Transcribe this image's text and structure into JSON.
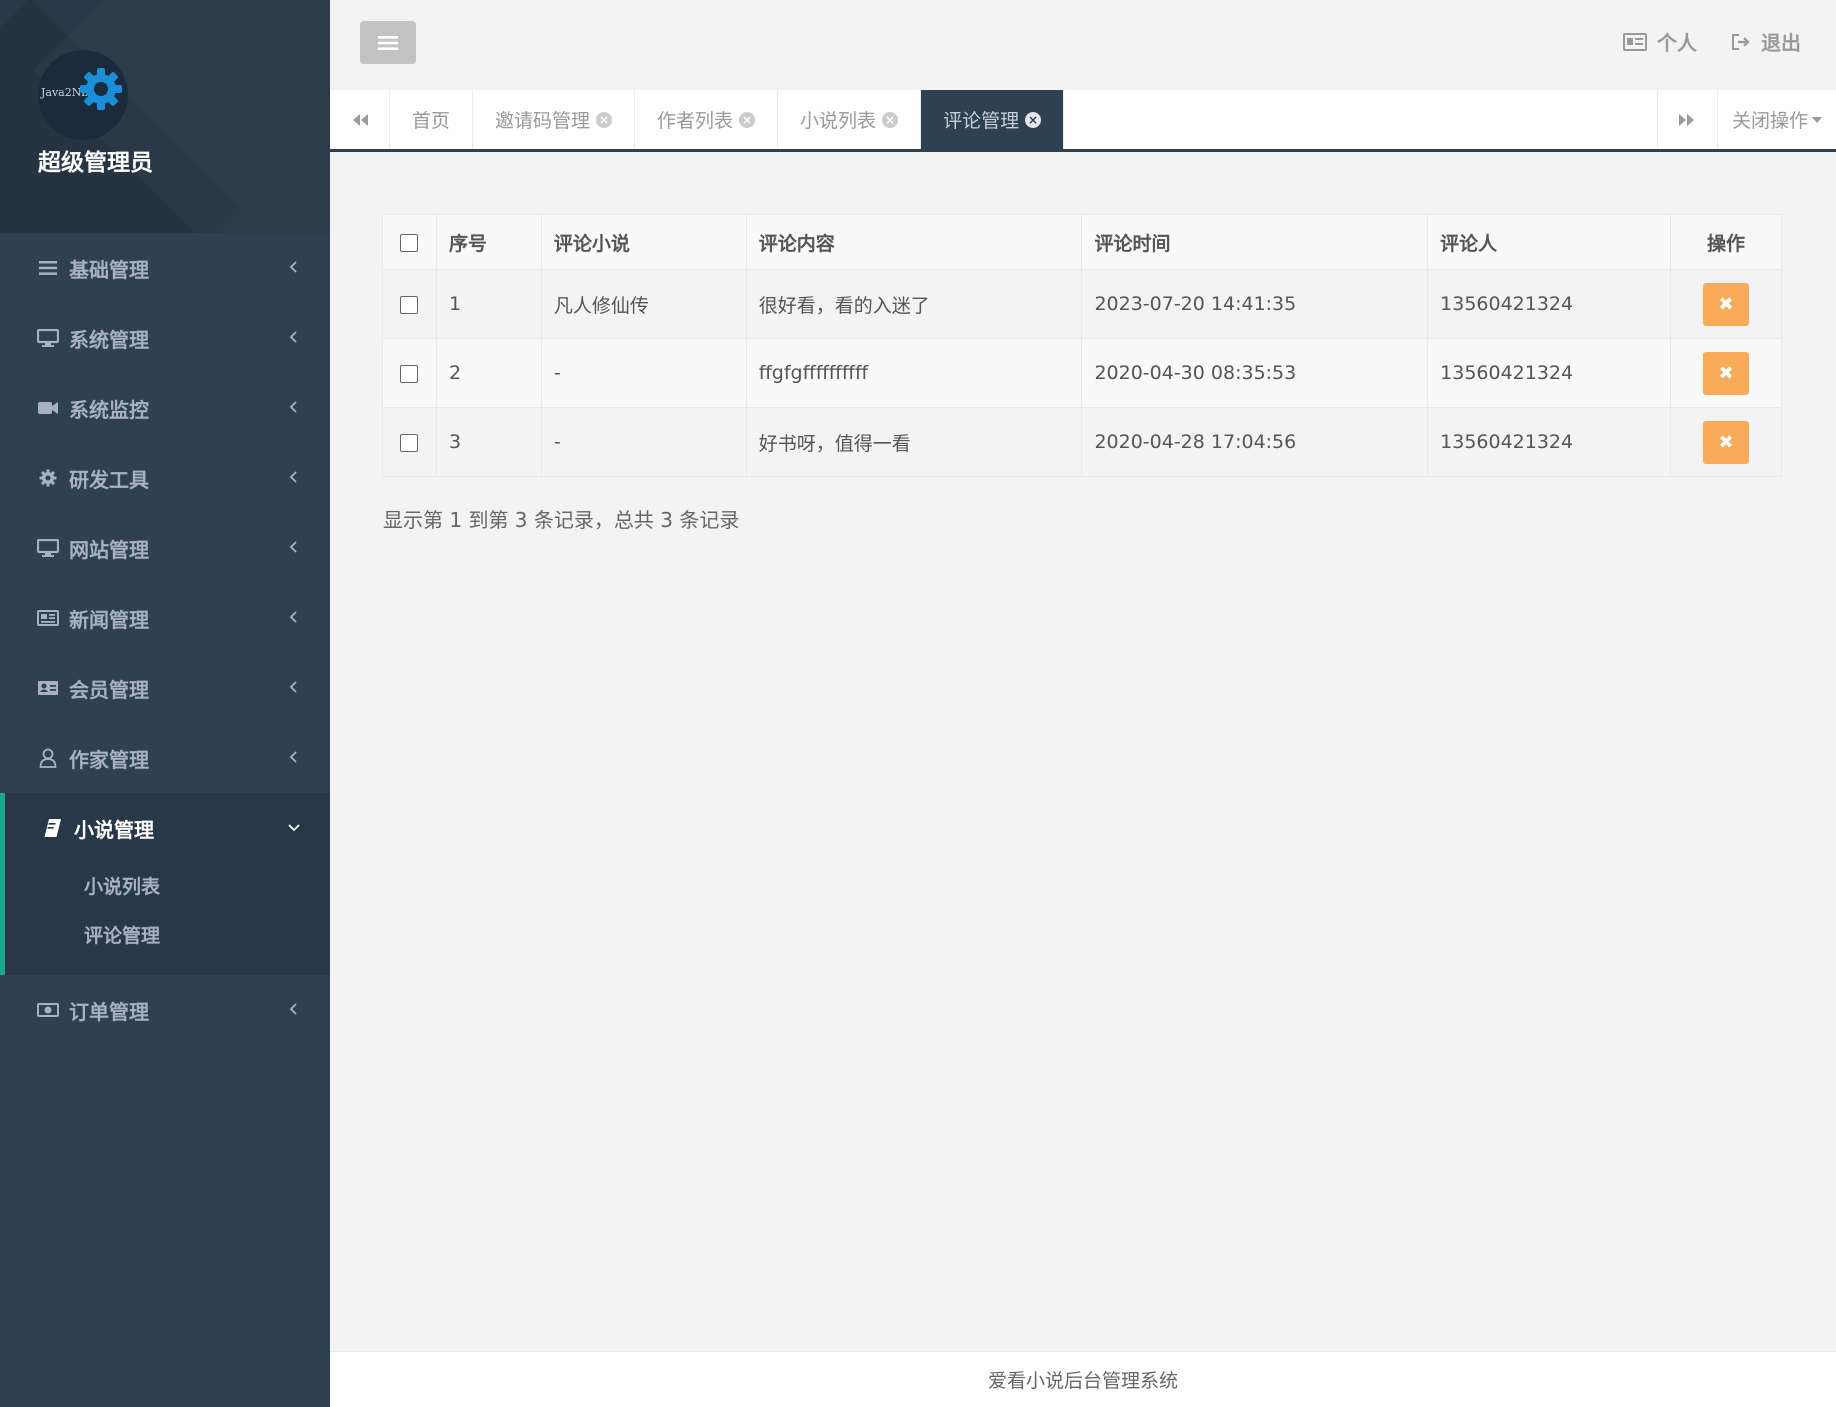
{
  "sidebar": {
    "avatar_text": "Java2Nb",
    "user_name": "超级管理员",
    "menu": [
      {
        "label": "基础管理",
        "icon": "bars-icon"
      },
      {
        "label": "系统管理",
        "icon": "desktop-icon"
      },
      {
        "label": "系统监控",
        "icon": "video-camera-icon"
      },
      {
        "label": "研发工具",
        "icon": "gear-icon"
      },
      {
        "label": "网站管理",
        "icon": "desktop-icon"
      },
      {
        "label": "新闻管理",
        "icon": "newspaper-icon"
      },
      {
        "label": "会员管理",
        "icon": "id-card-icon"
      },
      {
        "label": "作家管理",
        "icon": "user-icon"
      }
    ],
    "open_menu": {
      "label": "小说管理",
      "icon": "book-icon",
      "children": [
        "小说列表",
        "评论管理"
      ]
    },
    "after_menu": [
      {
        "label": "订单管理",
        "icon": "money-icon"
      }
    ]
  },
  "topbar": {
    "personal": "个人",
    "logout": "退出"
  },
  "tabs": {
    "items": [
      "首页",
      "邀请码管理",
      "作者列表",
      "小说列表",
      "评论管理"
    ],
    "active_index": 4,
    "close_ops": "关闭操作"
  },
  "table": {
    "headers": [
      "序号",
      "评论小说",
      "评论内容",
      "评论时间",
      "评论人",
      "操作"
    ],
    "rows": [
      {
        "no": "1",
        "novel": "凡人修仙传",
        "content": "很好看，看的入迷了",
        "time": "2023-07-20 14:41:35",
        "user": "13560421324"
      },
      {
        "no": "2",
        "novel": "-",
        "content": "ffgfgffffffffff",
        "time": "2020-04-30 08:35:53",
        "user": "13560421324"
      },
      {
        "no": "3",
        "novel": "-",
        "content": "好书呀，值得一看",
        "time": "2020-04-28 17:04:56",
        "user": "13560421324"
      }
    ],
    "pager_info": "显示第 1 到第 3 条记录，总共 3 条记录"
  },
  "footer": {
    "text": "爱看小说后台管理系统"
  },
  "colors": {
    "sidebar_bg": "#2f4050",
    "accent": "#19aa8d",
    "delete_button": "#f8ac59"
  }
}
